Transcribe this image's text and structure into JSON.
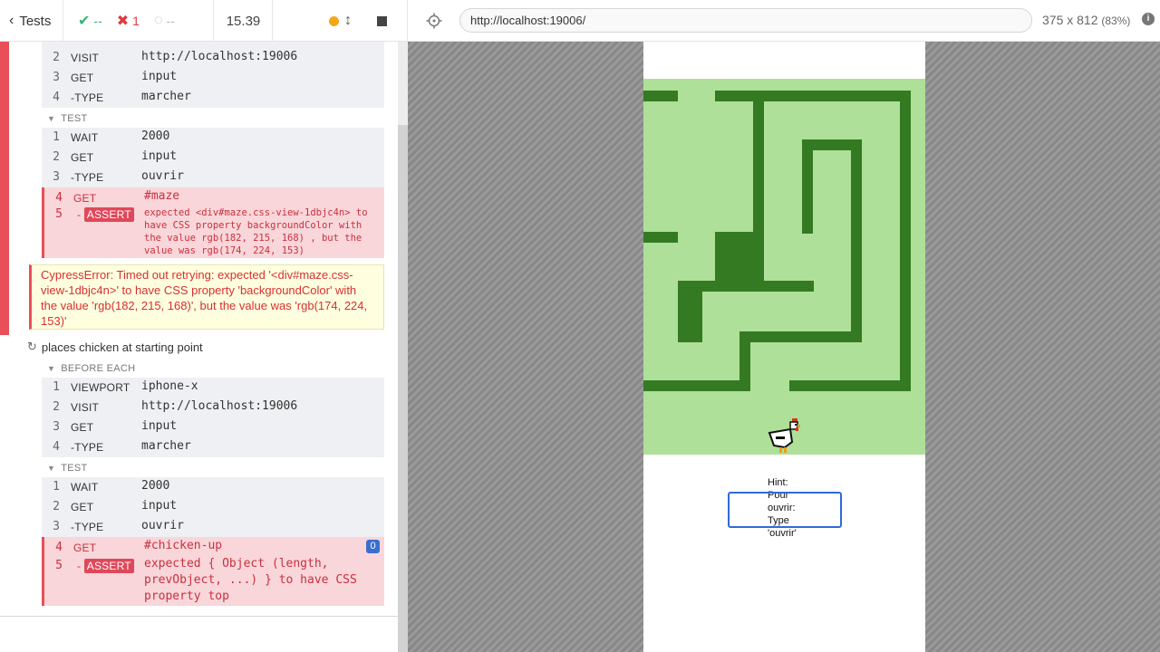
{
  "topbar": {
    "tests_label": "Tests",
    "passed": "--",
    "failed": "1",
    "pending": "--",
    "duration": "15.39",
    "url": "http://localhost:19006/",
    "viewport_size": "375 x 812",
    "viewport_scale": "(83%)",
    "info_icon": "i"
  },
  "reporter": {
    "block1": {
      "before_each_cmds": [
        {
          "num": "2",
          "name": "VISIT",
          "arg": "http://localhost:19006"
        },
        {
          "num": "3",
          "name": "GET",
          "arg": "input"
        },
        {
          "num": "4",
          "name": "-TYPE",
          "arg": "marcher"
        }
      ],
      "test_header": "TEST",
      "test_cmds": [
        {
          "num": "1",
          "name": "WAIT",
          "arg": "2000"
        },
        {
          "num": "2",
          "name": "GET",
          "arg": "input"
        },
        {
          "num": "3",
          "name": "-TYPE",
          "arg": "ouvrir"
        },
        {
          "num": "4",
          "name": "GET",
          "arg": "#maze"
        },
        {
          "num": "5",
          "name": "-",
          "badge": "ASSERT",
          "arg": "expected <div#maze.css-view-1dbjc4n> to have CSS property backgroundColor with the value rgb(182, 215, 168) , but the value was rgb(174, 224, 153)"
        }
      ],
      "error": "CypressError: Timed out retrying: expected '<div#maze.css-view-1dbjc4n>' to have CSS property 'backgroundColor' with the value 'rgb(182, 215, 168)', but the value was 'rgb(174, 224, 153)'"
    },
    "block2": {
      "title": "places chicken at starting point",
      "before_each_header": "BEFORE EACH",
      "before_each_cmds": [
        {
          "num": "1",
          "name": "VIEWPORT",
          "arg": "iphone-x"
        },
        {
          "num": "2",
          "name": "VISIT",
          "arg": "http://localhost:19006"
        },
        {
          "num": "3",
          "name": "GET",
          "arg": "input"
        },
        {
          "num": "4",
          "name": "-TYPE",
          "arg": "marcher"
        }
      ],
      "test_header": "TEST",
      "test_cmds": [
        {
          "num": "1",
          "name": "WAIT",
          "arg": "2000"
        },
        {
          "num": "2",
          "name": "GET",
          "arg": "input"
        },
        {
          "num": "3",
          "name": "-TYPE",
          "arg": "ouvrir"
        },
        {
          "num": "4",
          "name": "GET",
          "arg": "#chicken-up"
        },
        {
          "num": "5",
          "name": "-",
          "badge": "ASSERT",
          "arg": "expected { Object (length, prevObject, ...) } to have CSS property top"
        }
      ],
      "dom_badge": "0"
    }
  },
  "app": {
    "hint": "Hint:\nPour\nouvrir:\nType\n'ouvrir'",
    "input_value": ""
  },
  "colors": {
    "maze_bg": "#aee099",
    "maze_wall": "#347a22",
    "fail": "#e94f58",
    "pass": "#3cb46e"
  }
}
